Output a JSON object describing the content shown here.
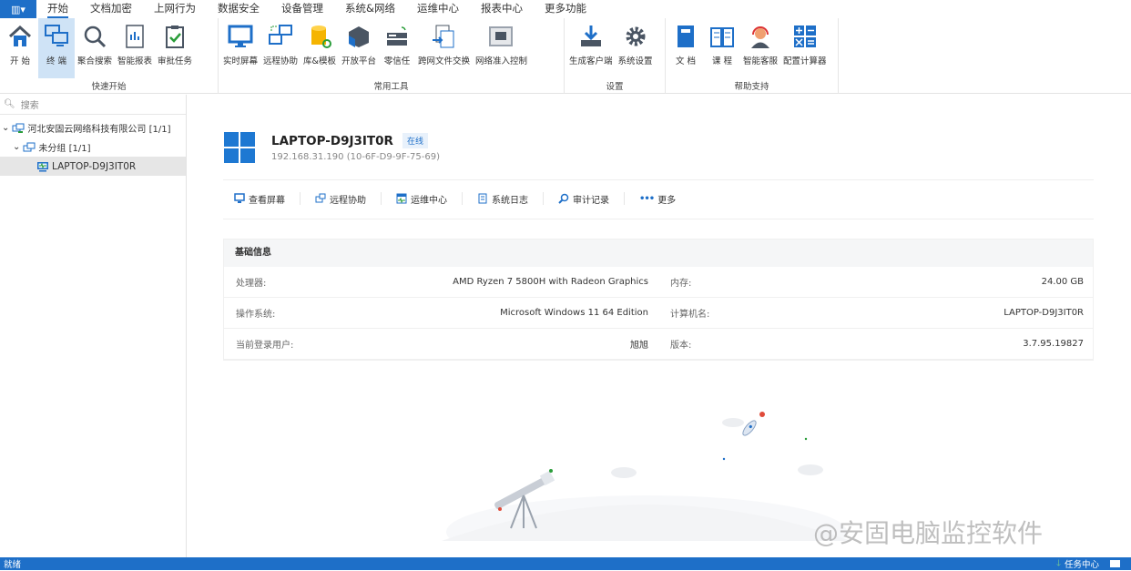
{
  "menu": {
    "app_icon": "app-menu-icon",
    "tabs": [
      "开始",
      "文档加密",
      "上网行为",
      "数据安全",
      "设备管理",
      "系统&网络",
      "运维中心",
      "报表中心",
      "更多功能"
    ],
    "active": 0
  },
  "ribbon": {
    "groups": [
      {
        "label": "快速开始",
        "items": [
          {
            "label": "开 始",
            "icon": "home-icon"
          },
          {
            "label": "终 端",
            "icon": "terminal-icon",
            "active": true
          },
          {
            "label": "聚合搜索",
            "icon": "search-icon"
          },
          {
            "label": "智能报表",
            "icon": "report-icon"
          },
          {
            "label": "审批任务",
            "icon": "approval-icon"
          }
        ]
      },
      {
        "label": "常用工具",
        "items": [
          {
            "label": "实时屏幕",
            "icon": "monitor-icon"
          },
          {
            "label": "远程协助",
            "icon": "remote-icon"
          },
          {
            "label": "库&模板",
            "icon": "database-icon"
          },
          {
            "label": "开放平台",
            "icon": "cube-icon"
          },
          {
            "label": "零信任",
            "icon": "server-icon"
          },
          {
            "label": "跨网文件交换",
            "icon": "file-exchange-icon"
          },
          {
            "label": "网络准入控制",
            "icon": "network-port-icon"
          }
        ]
      },
      {
        "label": "设置",
        "items": [
          {
            "label": "生成客户端",
            "icon": "download-icon"
          },
          {
            "label": "系统设置",
            "icon": "gear-icon"
          }
        ]
      },
      {
        "label": "帮助支持",
        "items": [
          {
            "label": "文 档",
            "icon": "book-icon"
          },
          {
            "label": "课 程",
            "icon": "open-book-icon"
          },
          {
            "label": "智能客服",
            "icon": "headset-icon"
          },
          {
            "label": "配置计算器",
            "icon": "calculator-icon"
          }
        ]
      }
    ]
  },
  "sidebar": {
    "search_placeholder": "搜索",
    "tree": [
      {
        "label": "河北安固云网络科技有限公司 [1/1]"
      },
      {
        "label": "未分组  [1/1]"
      },
      {
        "label": "LAPTOP-D9J3IT0R"
      }
    ]
  },
  "device": {
    "name": "LAPTOP-D9J3IT0R",
    "status": "在线",
    "ip": "192.168.31.190  (10-6F-D9-9F-75-69)"
  },
  "actions": [
    "查看屏幕",
    "远程协助",
    "运维中心",
    "系统日志",
    "审计记录",
    "更多"
  ],
  "info": {
    "title": "基础信息",
    "rows": [
      {
        "l": "处理器:",
        "v": "AMD Ryzen 7 5800H with Radeon Graphics",
        "l2": "内存:",
        "v2": "24.00 GB"
      },
      {
        "l": "操作系统:",
        "v": "Microsoft Windows 11  64 Edition",
        "l2": "计算机名:",
        "v2": "LAPTOP-D9J3IT0R"
      },
      {
        "l": "当前登录用户:",
        "v": "旭旭",
        "l2": "版本:",
        "v2": "3.7.95.19827"
      }
    ]
  },
  "watermark": "@安固电脑监控软件",
  "status": {
    "left": "就绪",
    "task_center": "任务中心"
  },
  "colors": {
    "accent": "#1e6fc8",
    "online": "#e8f1fb"
  }
}
